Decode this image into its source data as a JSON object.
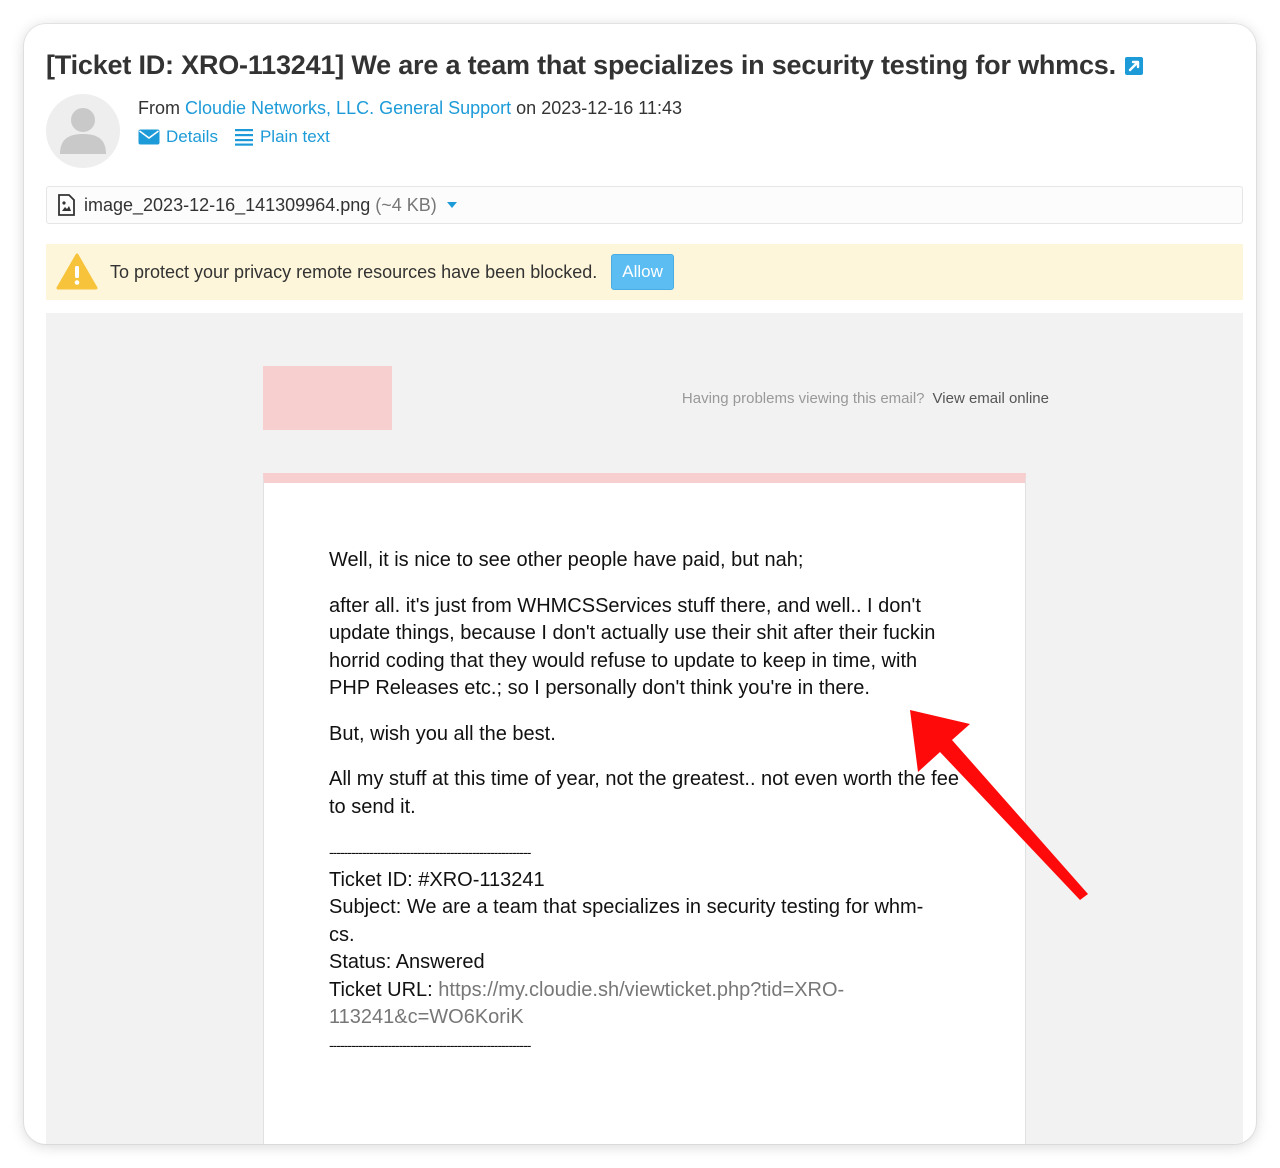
{
  "email": {
    "subject": "[Ticket ID: XRO-113241] We are a team that specializes in security testing for whmcs.",
    "from_prefix": "From ",
    "from_sender": "Cloudie Networks, LLC. General Support",
    "date_prefix": " on ",
    "date": "2023-12-16 11:43",
    "actions": {
      "details": "Details",
      "plain_text": "Plain text"
    }
  },
  "attachment": {
    "filename": "image_2023-12-16_141309964.png",
    "size": "(~4 KB)"
  },
  "privacy_notice": {
    "message": "To protect your privacy remote resources have been blocked.",
    "allow_label": "Allow"
  },
  "email_body": {
    "viewing_problem": "Having problems viewing this email?",
    "view_online": "View email online",
    "paragraphs": [
      "Well, it is nice to see other people have paid, but nah;",
      "after all. it's just from WHMCSServices stuff there, and well.. I don't update things, because I don't actually use their shit after their fuckin horrid coding that they would refuse to update to keep in time, with PHP Releases etc.; so I personally don't think you're in there.",
      "But, wish you all the best.",
      "All my stuff at this time of year, not the greatest.. not even worth the fee to send it."
    ],
    "signature": {
      "rule": "-------------------------------------------------------",
      "ticket_id": "Ticket ID: #XRO-113241",
      "subject_line_1": "Subject: We are a team that specializes in security testing for whm-",
      "subject_line_2": "cs.",
      "status": "Status: Answered",
      "url_label": "Ticket URL: ",
      "url_line_1": "https://my.cloudie.sh/viewticket.php?tid=XRO-",
      "url_line_2": "113241&c=WO6KoriK"
    }
  },
  "colors": {
    "link": "#1d9bd8",
    "notice_bg": "#fdf6da",
    "accent_pink": "#f8cfcf",
    "annotation_arrow": "#ff0a0a"
  }
}
